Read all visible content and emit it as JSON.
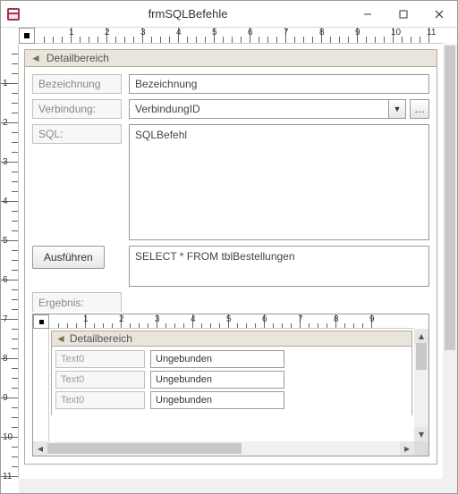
{
  "window": {
    "title": "frmSQLBefehle"
  },
  "section": {
    "header": "Detailbereich"
  },
  "labels": {
    "bezeichnung": "Bezeichnung",
    "verbindung": "Verbindung:",
    "sql": "SQL:",
    "ergebnis": "Ergebnis:"
  },
  "fields": {
    "bezeichnung": "Bezeichnung",
    "verbindung": "VerbindungID",
    "sqlbefehl": "SQLBefehl",
    "sql_sample": "SELECT * FROM tblBestellungen"
  },
  "buttons": {
    "ausfuehren": "Ausführen",
    "ellipsis": "…"
  },
  "subform": {
    "section_header": "Detailbereich",
    "rows": [
      {
        "label": "Text0",
        "value": "Ungebunden"
      },
      {
        "label": "Text0",
        "value": "Ungebunden"
      },
      {
        "label": "Text0",
        "value": "Ungebunden"
      }
    ]
  },
  "ruler": {
    "h_majors": [
      1,
      2,
      3,
      4,
      5,
      6,
      7,
      8,
      9,
      10,
      11
    ],
    "v_majors": [
      1,
      2,
      3,
      4,
      5,
      6,
      7,
      8,
      9,
      10,
      11
    ]
  }
}
